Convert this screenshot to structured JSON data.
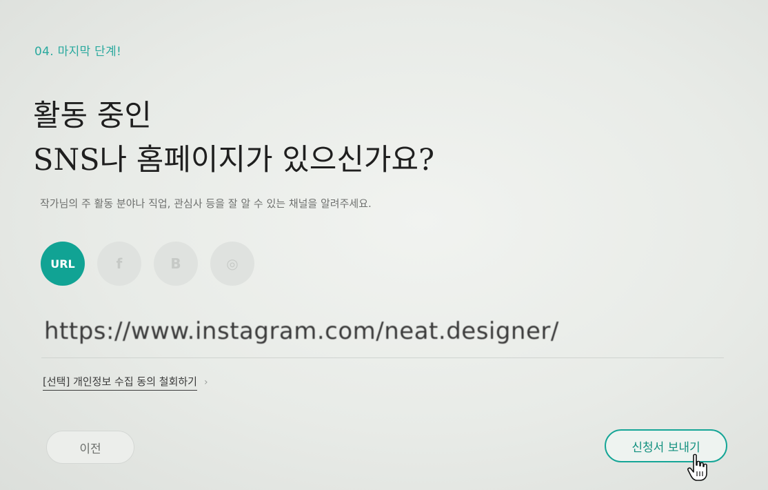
{
  "step": {
    "label": "04. 마지막 단계!"
  },
  "headline": {
    "line1": "활동 중인",
    "line2": "SNS나 홈페이지가 있으신가요?"
  },
  "subtext": "작가님의 주 활동 분야나 직업, 관심사 등을 잘 알 수 있는 채널을 알려주세요.",
  "channels": [
    {
      "id": "url",
      "label": "URL",
      "active": true,
      "icon": "url-icon"
    },
    {
      "id": "facebook",
      "label": "f",
      "active": false,
      "icon": "facebook-icon"
    },
    {
      "id": "blog",
      "label": "B",
      "active": false,
      "icon": "blog-icon"
    },
    {
      "id": "other",
      "label": "◎",
      "active": false,
      "icon": "instagram-icon"
    }
  ],
  "url_field": {
    "value": "https://www.instagram.com/neat.designer/"
  },
  "privacy": {
    "label": "[선택] 개인정보 수집 동의 철회하기",
    "chevron": "›"
  },
  "buttons": {
    "prev_label": "이전",
    "send_label": "신청서 보내기"
  },
  "colors": {
    "accent": "#11a394",
    "step_text": "#2aa99e"
  }
}
